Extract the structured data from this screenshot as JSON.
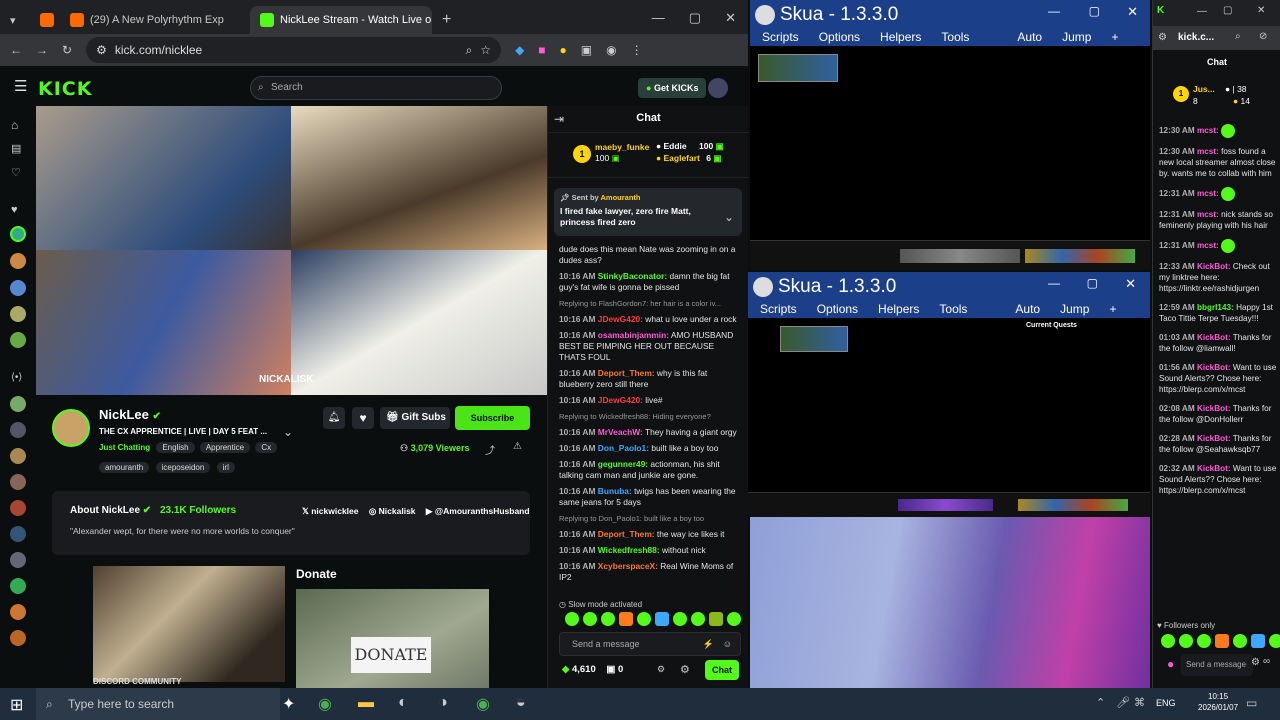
{
  "browser": {
    "tabs": [
      {
        "label": "(29) A New Polyrhythm Exp",
        "favicon_color": "#ff0000"
      },
      {
        "label": "NickLee Stream - Watch Live on",
        "favicon_color": "#53fc18"
      }
    ],
    "url": "kick.com/nicklee"
  },
  "kick": {
    "logo": "KICK",
    "search_placeholder": "Search",
    "get_kicks": "Get KICKs",
    "overlay_tag": "NICKALISK",
    "streamer": {
      "name": "NickLee",
      "title": "THE CX APPRENTICE | LIVE | DAY 5 FEAT ...",
      "category": "Just Chatting",
      "tags": [
        "English",
        "Apprentice",
        "Cx"
      ],
      "tags2": [
        "amouranth",
        "iceposeidon",
        "irl"
      ],
      "viewers": "3,079 Viewers",
      "gift_subs": "Gift Subs",
      "subscribe": "Subscribe"
    },
    "about": {
      "title": "About NickLee",
      "followers": "23.1K Followers",
      "socials": [
        "nickwicklee",
        "Nickalisk",
        "@AmouranthsHusband"
      ],
      "quote": "\"Alexander wept, for there were no more worlds to conquer\""
    },
    "donate_title": "Donate",
    "donate_sign": "DONATE",
    "discord_label": "DISCORD COMMUNITY",
    "chat": {
      "title": "Chat",
      "leaderboard": [
        {
          "rank": "1",
          "name": "maeby_funke",
          "value": "100"
        },
        {
          "rank": "",
          "name": "Eddie",
          "value": "100"
        },
        {
          "rank": "",
          "name": "Eaglefart",
          "value": "6"
        }
      ],
      "pinned": {
        "sent_by": "Sent by",
        "user": "Amouranth",
        "text": "I fired fake lawyer, zero fire Matt, princess fired zero"
      },
      "messages": [
        {
          "ts": "",
          "user": "",
          "color": "#ffffff",
          "text": "dude does this mean Nate was zooming in on a dudes ass?"
        },
        {
          "ts": "10:16 AM",
          "user": "StinkyBaconator:",
          "color": "#53fc18",
          "text": "damn the big fat guy's fat wife is gonna be pissed"
        },
        {
          "ts": "",
          "user": "",
          "color": "#999999",
          "text": "Replying to FlashGordon7: her hair is a color iv..."
        },
        {
          "ts": "10:16 AM",
          "user": "JDewG420:",
          "color": "#ff3b3b",
          "text": "what u love under a rock"
        },
        {
          "ts": "10:16 AM",
          "user": "osamabinjammin:",
          "color": "#ff5ad7",
          "text": "AMO HUSBAND BEST BE PIMPING HER OUT BECAUSE THATS FOUL"
        },
        {
          "ts": "10:16 AM",
          "user": "Deport_Them:",
          "color": "#ff7a1a",
          "text": "why is this fat blueberry zero still there"
        },
        {
          "ts": "10:16 AM",
          "user": "JDewG420:",
          "color": "#ff3b3b",
          "text": "live#"
        },
        {
          "ts": "",
          "user": "",
          "color": "#999999",
          "text": "Replying to Wickedfresh88: Hiding everyone?"
        },
        {
          "ts": "10:16 AM",
          "user": "MrVeachW:",
          "color": "#ff5ad7",
          "text": "They having a giant orgy"
        },
        {
          "ts": "10:16 AM",
          "user": "Don_Paolo1:",
          "color": "#3da8ff",
          "text": "built like a boy too"
        },
        {
          "ts": "10:16 AM",
          "user": "gegunner49:",
          "color": "#53fc18",
          "text": "actionman, his shit talking cam man and junkie are gone."
        },
        {
          "ts": "10:16 AM",
          "user": "Bunuba:",
          "color": "#3da8ff",
          "text": "twigs has been wearing the same jeans for 5 days"
        },
        {
          "ts": "",
          "user": "",
          "color": "#999999",
          "text": "Replying to Don_Paolo1: built like a boy too"
        },
        {
          "ts": "10:16 AM",
          "user": "Deport_Them:",
          "color": "#ff7a1a",
          "text": "the way ice likes it"
        },
        {
          "ts": "10:16 AM",
          "user": "Wickedfresh88:",
          "color": "#53fc18",
          "text": "without nick"
        },
        {
          "ts": "10:16 AM",
          "user": "XcyberspaceX:",
          "color": "#ff7a1a",
          "text": "Real Wine Moms of IP2"
        }
      ],
      "slow_mode": "Slow mode activated",
      "input_placeholder": "Send a message",
      "kicks_count": "4,610",
      "zero_count": "0",
      "send_label": "Chat"
    }
  },
  "skua": {
    "title": "Skua - 1.3.3.0",
    "menu": [
      "Scripts",
      "Options",
      "Helpers",
      "Tools"
    ],
    "menu_right": [
      "Auto",
      "Jump"
    ],
    "panel_title": "Current Quests"
  },
  "right_chat": {
    "url": "kick.c...",
    "title": "Chat",
    "stats": [
      {
        "name": "Jus...",
        "a": "38",
        "b": "8",
        "c": "14"
      }
    ],
    "messages": [
      {
        "ts": "12:30 AM",
        "user": "mcst:",
        "color": "#ff5ad7",
        "text": ""
      },
      {
        "ts": "12:30 AM",
        "user": "mcst:",
        "color": "#ff5ad7",
        "text": "foss found a new local streamer almost close by. wants me to collab with him"
      },
      {
        "ts": "12:31 AM",
        "user": "mcst:",
        "color": "#ff5ad7",
        "text": ""
      },
      {
        "ts": "12:31 AM",
        "user": "mcst:",
        "color": "#ff5ad7",
        "text": "nick stands so feminenly playing with his hair"
      },
      {
        "ts": "12:31 AM",
        "user": "mcst:",
        "color": "#ff5ad7",
        "text": ""
      },
      {
        "ts": "12:33 AM",
        "user": "KickBot:",
        "color": "#ff5ad7",
        "text": "Check out my linktree here: https://linktr.ee/rashidjurgen"
      },
      {
        "ts": "12:59 AM",
        "user": "bbgrl143:",
        "color": "#53fc18",
        "text": "Happy 1st Taco Tittie Terpe Tuesday!!!"
      },
      {
        "ts": "01:03 AM",
        "user": "KickBot:",
        "color": "#ff5ad7",
        "text": "Thanks for the follow @liamwall!"
      },
      {
        "ts": "01:56 AM",
        "user": "KickBot:",
        "color": "#ff5ad7",
        "text": "Want to use Sound Alerts?? Chose here: https://blerp.com/x/mcst"
      },
      {
        "ts": "02:08 AM",
        "user": "KickBot:",
        "color": "#ff5ad7",
        "text": "Thanks for the follow @DonHollerr"
      },
      {
        "ts": "02:28 AM",
        "user": "KickBot:",
        "color": "#ff5ad7",
        "text": "Thanks for the follow @Seahawksqb77"
      },
      {
        "ts": "02:32 AM",
        "user": "KickBot:",
        "color": "#ff5ad7",
        "text": "Want to use Sound Alerts?? Chose here: https://blerp.com/x/mcst"
      }
    ],
    "followers_only": "Followers only",
    "input_placeholder": "Send a message"
  },
  "taskbar": {
    "search_placeholder": "Type here to search",
    "lang": "ENG",
    "time": "10:15",
    "date": "2026/01/07"
  }
}
